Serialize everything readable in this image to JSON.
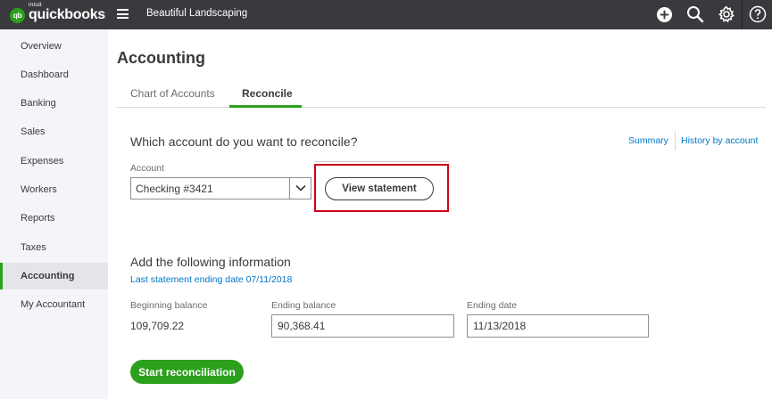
{
  "app": {
    "logo_badge": "qb",
    "logo_brand": "intuit",
    "logo_product": "quickbooks",
    "company_name": "Beautiful Landscaping",
    "icons": [
      "plus-circle-icon",
      "search-icon",
      "gear-icon",
      "help-icon"
    ]
  },
  "sidebar": {
    "items": [
      {
        "label": "Overview"
      },
      {
        "label": "Dashboard"
      },
      {
        "label": "Banking"
      },
      {
        "label": "Sales"
      },
      {
        "label": "Expenses"
      },
      {
        "label": "Workers"
      },
      {
        "label": "Reports"
      },
      {
        "label": "Taxes"
      },
      {
        "label": "Accounting"
      },
      {
        "label": "My Accountant"
      }
    ],
    "active": "Accounting"
  },
  "main": {
    "title": "Accounting",
    "tabs": [
      {
        "label": "Chart of Accounts"
      },
      {
        "label": "Reconcile"
      }
    ],
    "active_tab": "Reconcile",
    "question": "Which account do you want to reconcile?",
    "links": {
      "summary": "Summary",
      "history": "History by account"
    },
    "account": {
      "label": "Account",
      "value": "Checking #3421",
      "view_statement": "View statement"
    },
    "info": {
      "title": "Add the following information",
      "last_statement": "Last statement ending date 07/11/2018",
      "beginning_balance_label": "Beginning balance",
      "beginning_balance": "109,709.22",
      "ending_balance_label": "Ending balance",
      "ending_balance": "90,368.41",
      "ending_date_label": "Ending date",
      "ending_date": "11/13/2018"
    },
    "start_button": "Start reconciliation"
  },
  "colors": {
    "topbar": "#393a3d",
    "accent_green": "#2ca01c",
    "link_blue": "#0077c5",
    "highlight_red": "#d0021b"
  }
}
